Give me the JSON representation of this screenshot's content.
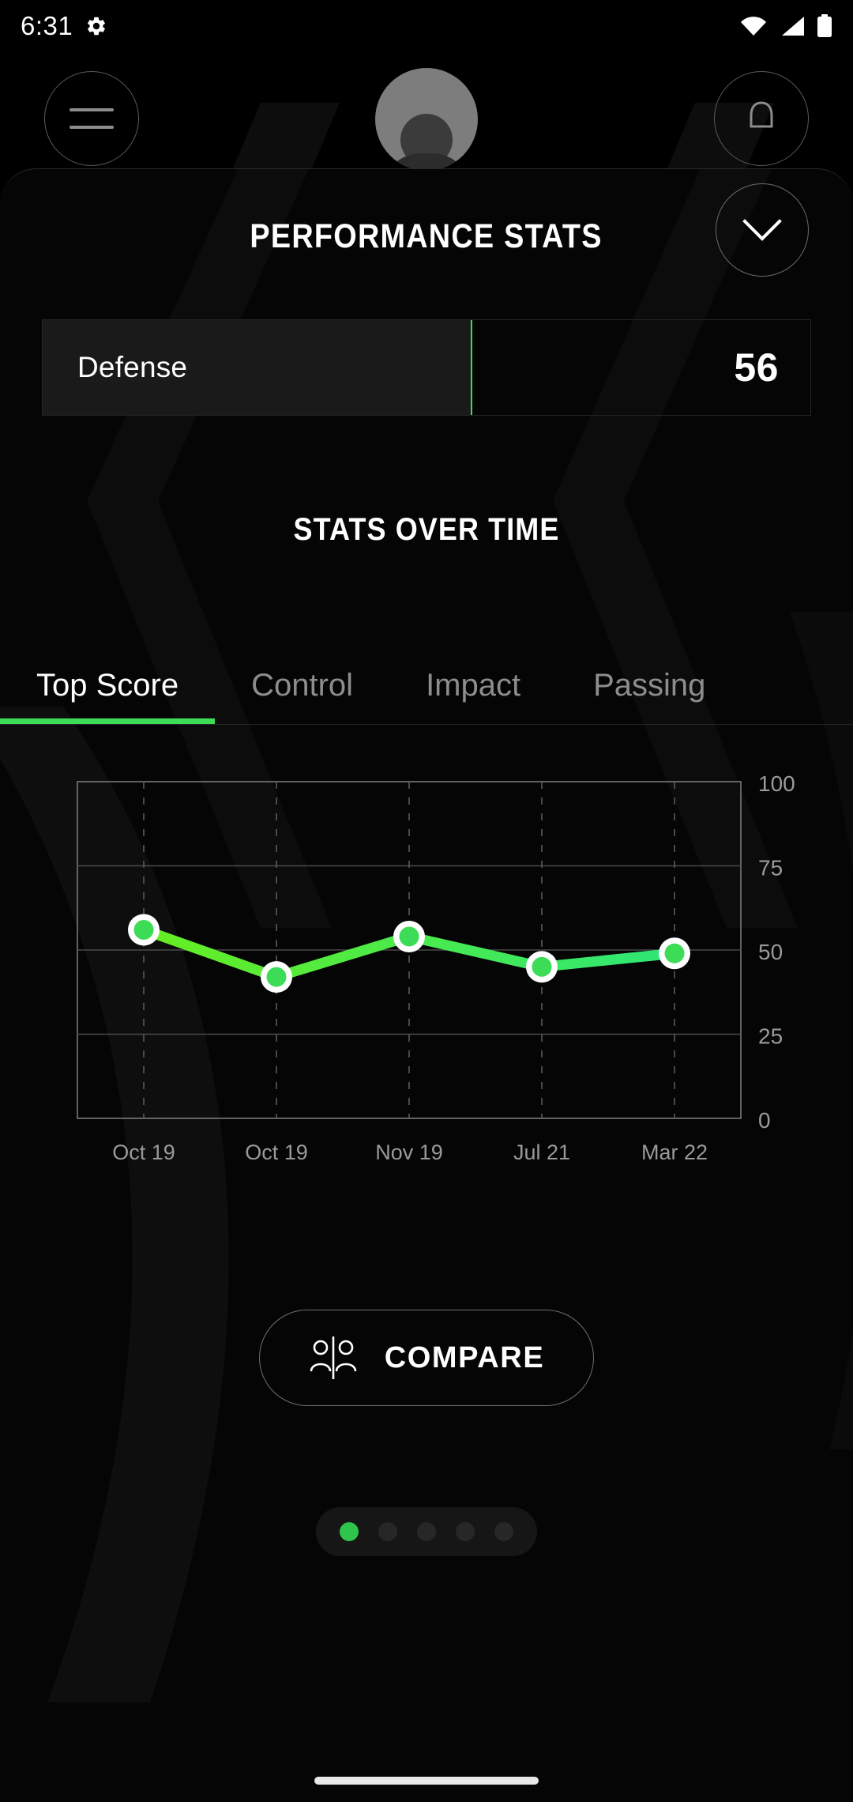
{
  "status_bar": {
    "time": "6:31",
    "icons": [
      "gear-icon",
      "wifi-icon",
      "cellular-signal-icon",
      "battery-icon"
    ]
  },
  "app_bar": {
    "menu_icon": "hamburger-menu-icon",
    "avatar": "user-avatar",
    "notification_icon": "bell-icon"
  },
  "sheet": {
    "header": {
      "title": "PERFORMANCE STATS",
      "collapse_icon": "chevron-down-icon"
    },
    "stat": {
      "label": "Defense",
      "value": "56",
      "percent": 56,
      "accent": "#3ddc57"
    },
    "section_title": "STATS OVER TIME",
    "tabs": [
      {
        "label": "Top Score",
        "active": true
      },
      {
        "label": "Control",
        "active": false
      },
      {
        "label": "Impact",
        "active": false
      },
      {
        "label": "Passing",
        "active": false
      }
    ],
    "compare": {
      "label": "COMPARE",
      "icon": "compare-people-icon"
    },
    "pager": {
      "count": 5,
      "active_index": 0,
      "active_color": "#2fc44a",
      "inactive_color": "#272727"
    }
  },
  "chart_data": {
    "type": "line",
    "title": "Top Score over time",
    "xlabel": "",
    "ylabel": "",
    "categories": [
      "Oct 19",
      "Oct 19",
      "Nov 19",
      "Jul 21",
      "Mar 22"
    ],
    "values": [
      56,
      42,
      54,
      45,
      49
    ],
    "series": [
      {
        "name": "Top Score",
        "values": [
          56,
          42,
          54,
          45,
          49
        ]
      }
    ],
    "ylim": [
      0,
      100
    ],
    "yticks": [
      0,
      25,
      50,
      75,
      100
    ],
    "ytick_labels": [
      "0",
      "25",
      "50",
      "75",
      "100"
    ],
    "xtick_labels": [
      "Oct 19",
      "Oct 19",
      "Nov 19",
      "Jul 21",
      "Mar 22"
    ],
    "grid": true,
    "grid_style": "horizontal solid, vertical dashed",
    "legend": false,
    "line_color_start": "#66ee22",
    "line_color_end": "#2ee676",
    "marker_ring_color": "#ffffff",
    "marker_fill_color": "#3ddc57",
    "axis_color": "#7a7a7a",
    "tick_label_color": "#9a9a9a",
    "background": "#000000"
  }
}
